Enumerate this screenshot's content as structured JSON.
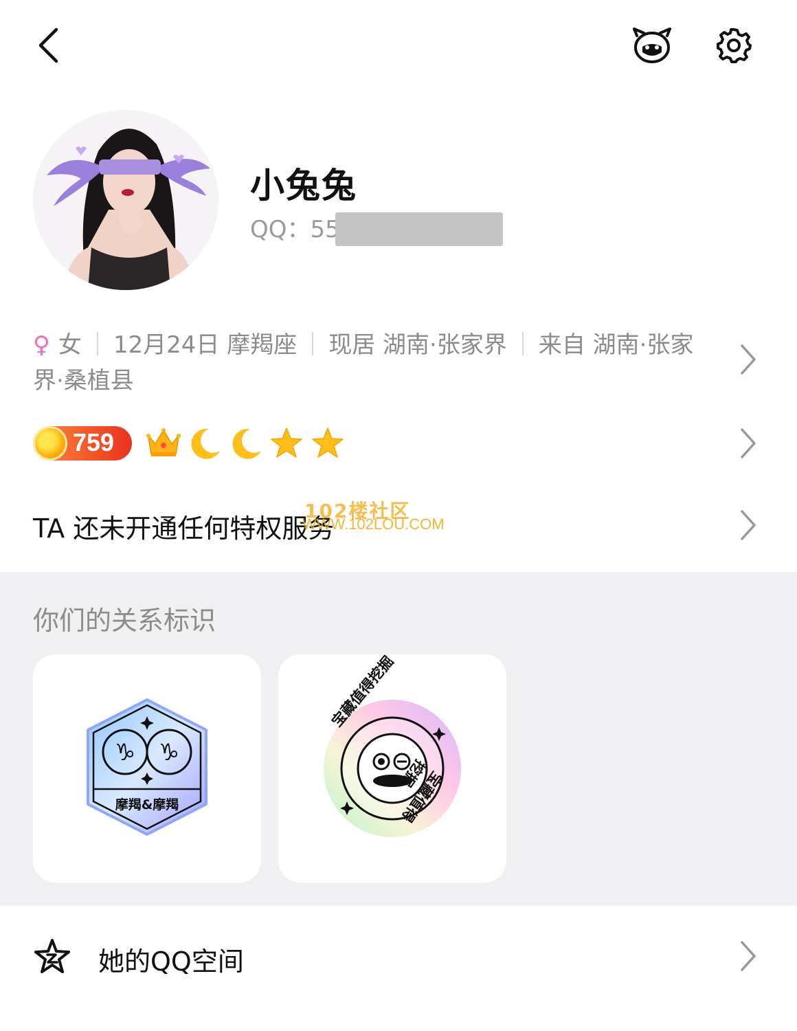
{
  "profile": {
    "nickname": "小兔兔",
    "qq_label": "QQ：",
    "qq_number_visible": "55"
  },
  "info": {
    "gender_symbol": "♀",
    "gender": "女",
    "birthday": "12月24日 摩羯座",
    "residence": "现居 湖南·张家界",
    "hometown": "来自 湖南·张家界·桑植县"
  },
  "level": {
    "value": "759",
    "icons": [
      "crown-icon",
      "moon-icon",
      "moon-icon",
      "star-icon",
      "star-icon"
    ]
  },
  "privilege": {
    "text": "TA 还未开通任何特权服务"
  },
  "watermark": {
    "line1": "102楼社区",
    "line2": "WWW.102LOU.COM"
  },
  "relation": {
    "title": "你们的关系标识",
    "cards": [
      {
        "icon": "capricorn-badge-icon",
        "label": "摩羯&摩羯"
      },
      {
        "icon": "treasure-badge-icon",
        "label": "宝藏值得挖掘"
      }
    ]
  },
  "qzone": {
    "label": "她的QQ空间",
    "icon": "qzone-star-icon"
  },
  "colors": {
    "accent_female": "#f16fb6",
    "level_badge": "#e8321f",
    "section_bg": "#f0f0f2",
    "gray_text": "#8c8c8c"
  }
}
